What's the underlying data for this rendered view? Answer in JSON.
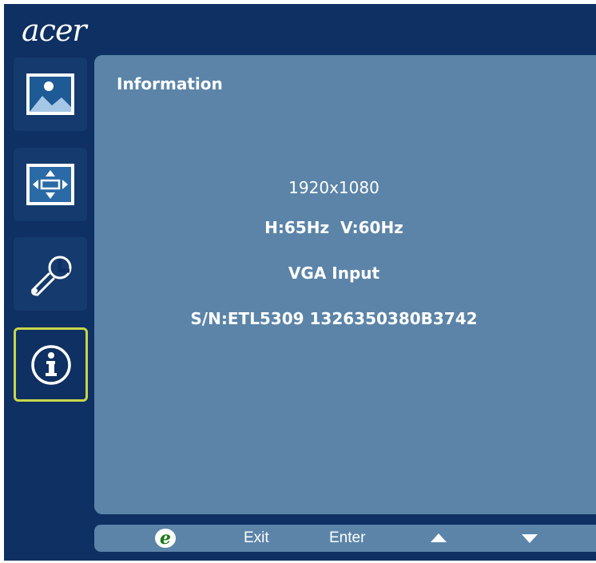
{
  "brand": {
    "logo_text": "acer"
  },
  "sidebar": {
    "tabs": [
      {
        "icon": "picture-icon"
      },
      {
        "icon": "position-icon"
      },
      {
        "icon": "settings-wrench-icon"
      },
      {
        "icon": "info-icon",
        "active": true
      }
    ]
  },
  "panel": {
    "title": "Information",
    "resolution": "1920x1080",
    "frequency": "H:65Hz  V:60Hz",
    "input": "VGA Input",
    "serial": "S/N:ETL5309 1326350380B3742"
  },
  "footer": {
    "exit_label": "Exit",
    "enter_label": "Enter",
    "icons": [
      "acer-empowering-e-icon",
      "up-triangle-icon",
      "down-triangle-icon"
    ]
  },
  "colors": {
    "background": "#0e3062",
    "panel": "#5b84a8",
    "active_border": "#c8d64a",
    "text": "#ffffff"
  }
}
